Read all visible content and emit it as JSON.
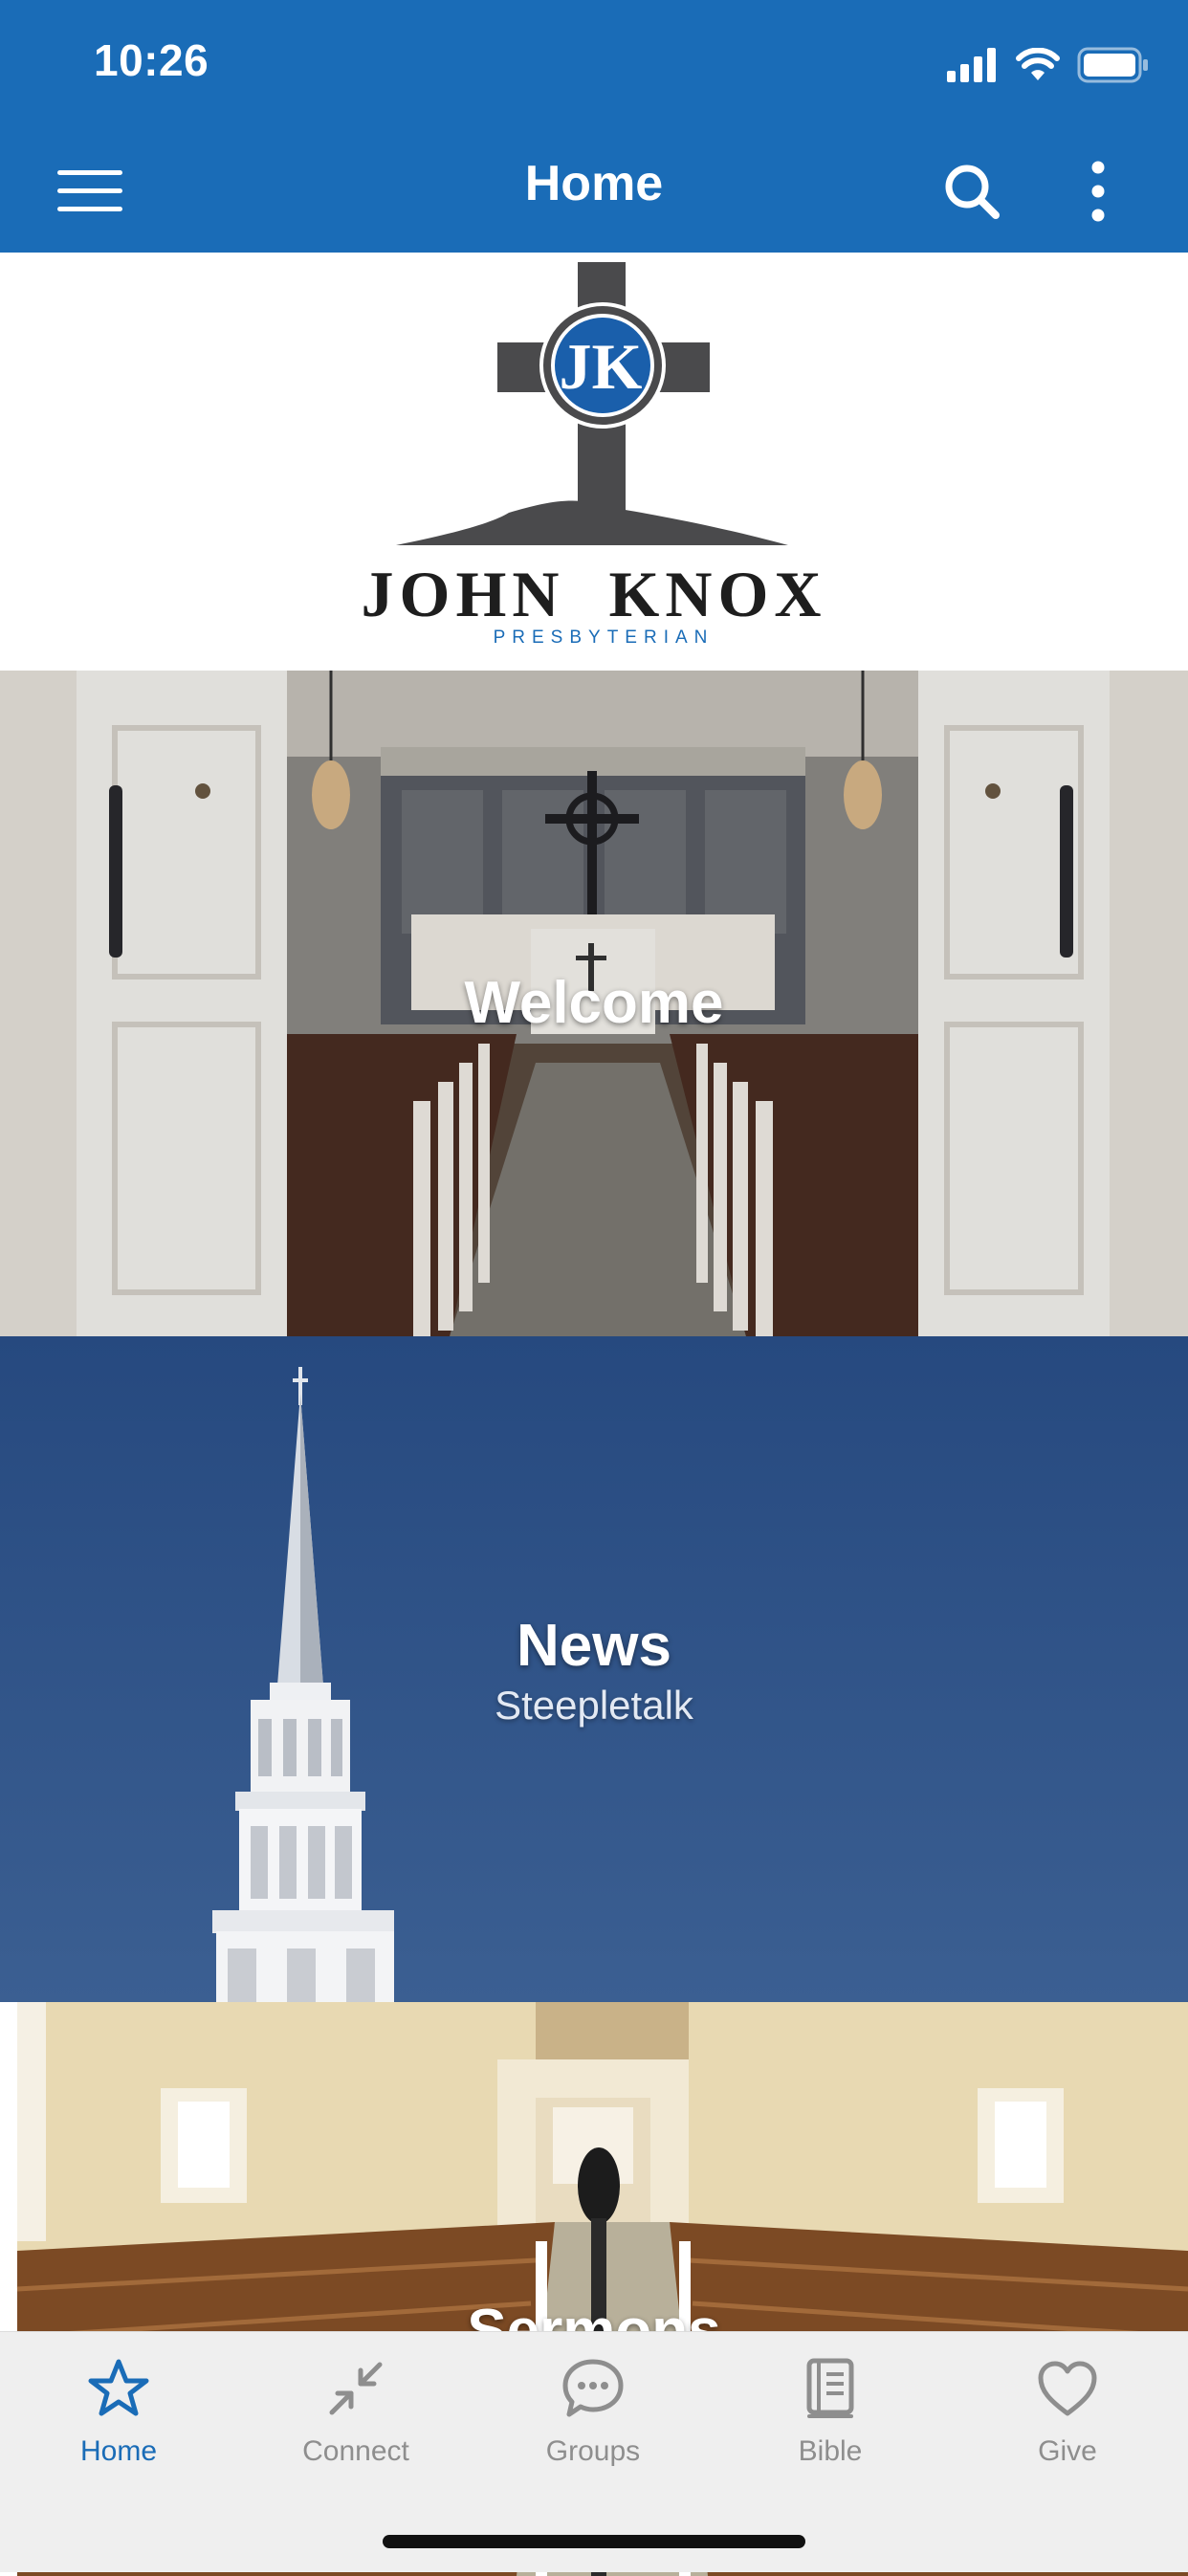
{
  "status_bar": {
    "time": "10:26"
  },
  "nav": {
    "title": "Home",
    "menu_icon": "hamburger-menu-icon",
    "search_icon": "search-icon",
    "more_icon": "more-vertical-icon"
  },
  "logo": {
    "monogram": "JK",
    "name": "JOHN  KNOX",
    "subtitle": "PRESBYTERIAN"
  },
  "tiles": [
    {
      "title": "Welcome",
      "subtitle": ""
    },
    {
      "title": "News",
      "subtitle": "Steepletalk"
    },
    {
      "title": "Sermons",
      "subtitle": ""
    }
  ],
  "tabs": [
    {
      "label": "Home",
      "icon": "star-icon",
      "active": true
    },
    {
      "label": "Connect",
      "icon": "connect-arrows-icon",
      "active": false
    },
    {
      "label": "Groups",
      "icon": "chat-bubble-icon",
      "active": false
    },
    {
      "label": "Bible",
      "icon": "book-icon",
      "active": false
    },
    {
      "label": "Give",
      "icon": "heart-icon",
      "active": false
    }
  ],
  "colors": {
    "brand_blue": "#1a6cb7",
    "tab_inactive": "#8e8e8e",
    "logo_gray": "#4a4a4c"
  }
}
